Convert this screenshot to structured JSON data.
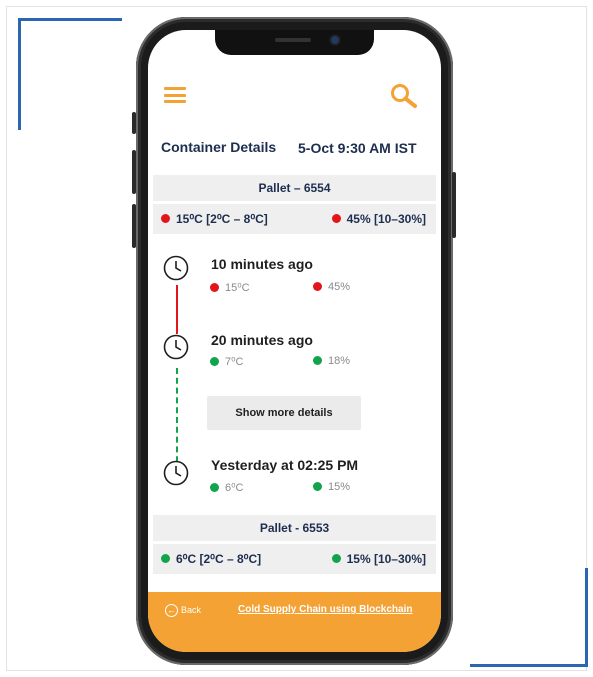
{
  "header": {
    "title": "Container Details",
    "datetime": "5-Oct 9:30 AM IST"
  },
  "icons": {
    "menu": "hamburger-menu-icon",
    "search": "search-icon",
    "clock": "clock-icon",
    "back": "back-arrow-icon"
  },
  "colors": {
    "accent": "#f4a233",
    "alert": "#e4141b",
    "ok": "#12a44a",
    "title_text": "#1d2e4f",
    "frame_bracket": "#2a67b0"
  },
  "pallets": [
    {
      "name": "Pallet – 6554",
      "temperature": "15⁰C [2⁰C – 8⁰C]",
      "temperature_status": "alert",
      "humidity": "45% [10–30%]",
      "humidity_status": "alert"
    },
    {
      "name": "Pallet - 6553",
      "temperature": "6⁰C [2⁰C – 8⁰C]",
      "temperature_status": "ok",
      "humidity": "15% [10–30%]",
      "humidity_status": "ok"
    }
  ],
  "timeline": [
    {
      "time": "10 minutes ago",
      "temperature": "15⁰C",
      "temperature_status": "alert",
      "humidity": "45%",
      "humidity_status": "alert"
    },
    {
      "time": "20 minutes ago",
      "temperature": "7⁰C",
      "temperature_status": "ok",
      "humidity": "18%",
      "humidity_status": "ok"
    },
    {
      "time": "Yesterday at  02:25 PM",
      "temperature": "6⁰C",
      "temperature_status": "ok",
      "humidity": "15%",
      "humidity_status": "ok"
    }
  ],
  "show_more_label": "Show more details",
  "footer": {
    "back_label": "Back",
    "link_label": "Cold Supply Chain using Blockchain"
  }
}
